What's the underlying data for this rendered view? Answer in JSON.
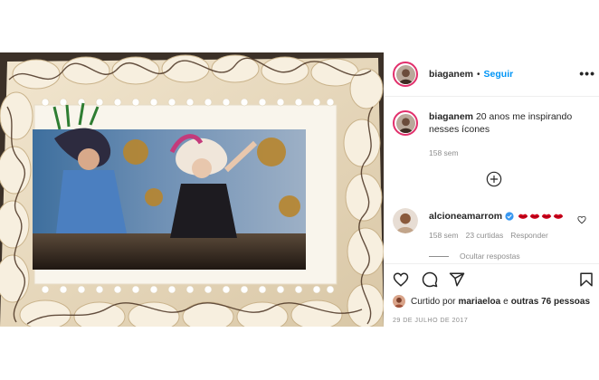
{
  "post": {
    "username": "biaganem",
    "separator": "•",
    "follow_label": "Seguir",
    "more_label": "•••",
    "caption_user": "biaganem",
    "caption_text": "20 anos me inspirando nesses ícones",
    "caption_time": "158 sem",
    "comment": {
      "user": "alcioneamarrom",
      "time": "158 sem",
      "likes": "23 curtidas",
      "reply_label": "Responder",
      "hide_replies": "Ocultar respostas"
    },
    "liked_by_prefix": "Curtido por",
    "liked_by_user": "mariaeloa",
    "liked_by_joiner": "e",
    "liked_by_others": "outras 76 pessoas",
    "date": "29 DE JULHO DE 2017"
  },
  "colors": {
    "follow": "#0095f6",
    "story_ring": "#e1306c",
    "verified": "#3897f0",
    "lips": "#d0021b"
  },
  "icons": [
    "more-icon",
    "add-circle-icon",
    "verified-badge-icon",
    "lips-emoji",
    "heart-icon",
    "comment-icon",
    "share-icon",
    "bookmark-icon"
  ]
}
